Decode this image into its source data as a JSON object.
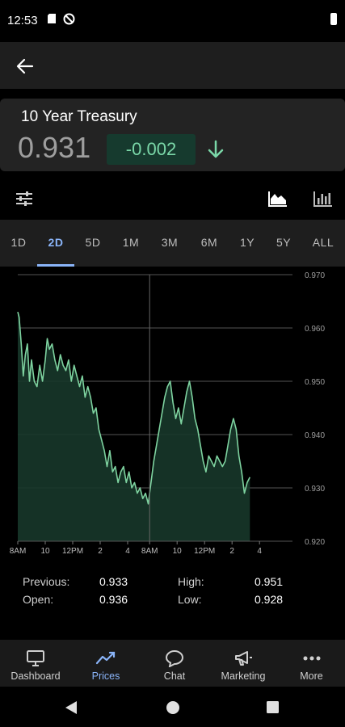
{
  "status_bar": {
    "time": "12:53",
    "icons": [
      "sd-card-icon",
      "no-disturb-icon",
      "battery-icon"
    ]
  },
  "header": {
    "back_icon": "arrow-left-icon"
  },
  "quote": {
    "title": "10 Year Treasury",
    "price": "0.931",
    "change": "-0.002",
    "change_color": "#7ad7a8",
    "direction_icon": "arrow-down-icon"
  },
  "toolbar": {
    "icons": [
      "filter-sliders-icon",
      "area-chart-icon",
      "bar-chart-icon"
    ]
  },
  "range_tabs": {
    "tabs": [
      "1D",
      "2D",
      "5D",
      "1M",
      "3M",
      "6M",
      "1Y",
      "5Y",
      "ALL"
    ],
    "selected": "2D",
    "accent_color": "#8ab4f8"
  },
  "chart_data": {
    "type": "area",
    "line_color": "#7ed3a0",
    "fill_color": "#17372a",
    "ylim": [
      0.92,
      0.97
    ],
    "y_ticks": [
      "0.970",
      "0.960",
      "0.950",
      "0.940",
      "0.930",
      "0.920"
    ],
    "x_ticks": [
      "8AM",
      "10",
      "12PM",
      "2",
      "4",
      "8AM",
      "10",
      "12PM",
      "2",
      "4"
    ],
    "x_range": [
      0,
      20
    ],
    "divider_x": 9.6,
    "grid": "horizontal",
    "series": [
      {
        "points": [
          [
            0.0,
            0.963
          ],
          [
            0.1,
            0.962
          ],
          [
            0.25,
            0.957
          ],
          [
            0.4,
            0.951
          ],
          [
            0.55,
            0.955
          ],
          [
            0.7,
            0.957
          ],
          [
            0.85,
            0.95
          ],
          [
            1.0,
            0.954
          ],
          [
            1.2,
            0.95
          ],
          [
            1.4,
            0.949
          ],
          [
            1.6,
            0.953
          ],
          [
            1.8,
            0.95
          ],
          [
            2.0,
            0.954
          ],
          [
            2.15,
            0.958
          ],
          [
            2.3,
            0.956
          ],
          [
            2.5,
            0.957
          ],
          [
            2.7,
            0.954
          ],
          [
            2.9,
            0.952
          ],
          [
            3.1,
            0.955
          ],
          [
            3.3,
            0.953
          ],
          [
            3.5,
            0.952
          ],
          [
            3.7,
            0.954
          ],
          [
            3.9,
            0.95
          ],
          [
            4.1,
            0.953
          ],
          [
            4.3,
            0.951
          ],
          [
            4.5,
            0.949
          ],
          [
            4.7,
            0.951
          ],
          [
            4.9,
            0.947
          ],
          [
            5.1,
            0.949
          ],
          [
            5.3,
            0.947
          ],
          [
            5.5,
            0.944
          ],
          [
            5.7,
            0.945
          ],
          [
            5.9,
            0.941
          ],
          [
            6.1,
            0.939
          ],
          [
            6.3,
            0.937
          ],
          [
            6.5,
            0.934
          ],
          [
            6.7,
            0.937
          ],
          [
            6.9,
            0.933
          ],
          [
            7.1,
            0.934
          ],
          [
            7.3,
            0.931
          ],
          [
            7.5,
            0.933
          ],
          [
            7.7,
            0.934
          ],
          [
            7.9,
            0.931
          ],
          [
            8.1,
            0.933
          ],
          [
            8.3,
            0.93
          ],
          [
            8.5,
            0.931
          ],
          [
            8.7,
            0.929
          ],
          [
            8.9,
            0.93
          ],
          [
            9.1,
            0.928
          ],
          [
            9.3,
            0.929
          ],
          [
            9.5,
            0.927
          ],
          [
            9.7,
            0.931
          ],
          [
            9.9,
            0.935
          ],
          [
            10.1,
            0.938
          ],
          [
            10.3,
            0.941
          ],
          [
            10.5,
            0.944
          ],
          [
            10.7,
            0.947
          ],
          [
            10.9,
            0.949
          ],
          [
            11.1,
            0.95
          ],
          [
            11.3,
            0.946
          ],
          [
            11.5,
            0.943
          ],
          [
            11.7,
            0.945
          ],
          [
            11.9,
            0.942
          ],
          [
            12.1,
            0.945
          ],
          [
            12.3,
            0.948
          ],
          [
            12.5,
            0.95
          ],
          [
            12.7,
            0.947
          ],
          [
            12.9,
            0.943
          ],
          [
            13.1,
            0.941
          ],
          [
            13.3,
            0.938
          ],
          [
            13.5,
            0.935
          ],
          [
            13.7,
            0.933
          ],
          [
            13.9,
            0.936
          ],
          [
            14.1,
            0.935
          ],
          [
            14.3,
            0.934
          ],
          [
            14.5,
            0.936
          ],
          [
            14.7,
            0.935
          ],
          [
            14.9,
            0.934
          ],
          [
            15.1,
            0.935
          ],
          [
            15.3,
            0.938
          ],
          [
            15.5,
            0.941
          ],
          [
            15.7,
            0.943
          ],
          [
            15.9,
            0.941
          ],
          [
            16.1,
            0.936
          ],
          [
            16.3,
            0.933
          ],
          [
            16.5,
            0.929
          ],
          [
            16.7,
            0.931
          ],
          [
            16.9,
            0.932
          ]
        ]
      }
    ]
  },
  "stats": {
    "previous_label": "Previous:",
    "previous_value": "0.933",
    "open_label": "Open:",
    "open_value": "0.936",
    "high_label": "High:",
    "high_value": "0.951",
    "low_label": "Low:",
    "low_value": "0.928"
  },
  "bottom_nav": {
    "items": [
      {
        "label": "Dashboard",
        "icon": "monitor-icon"
      },
      {
        "label": "Prices",
        "icon": "trend-line-icon"
      },
      {
        "label": "Chat",
        "icon": "chat-bubble-icon"
      },
      {
        "label": "Marketing",
        "icon": "megaphone-icon"
      },
      {
        "label": "More",
        "icon": "more-dots-icon"
      }
    ],
    "active": "Prices"
  },
  "system_nav": {
    "icons": [
      "back-triangle-icon",
      "home-circle-icon",
      "recents-square-icon"
    ]
  }
}
